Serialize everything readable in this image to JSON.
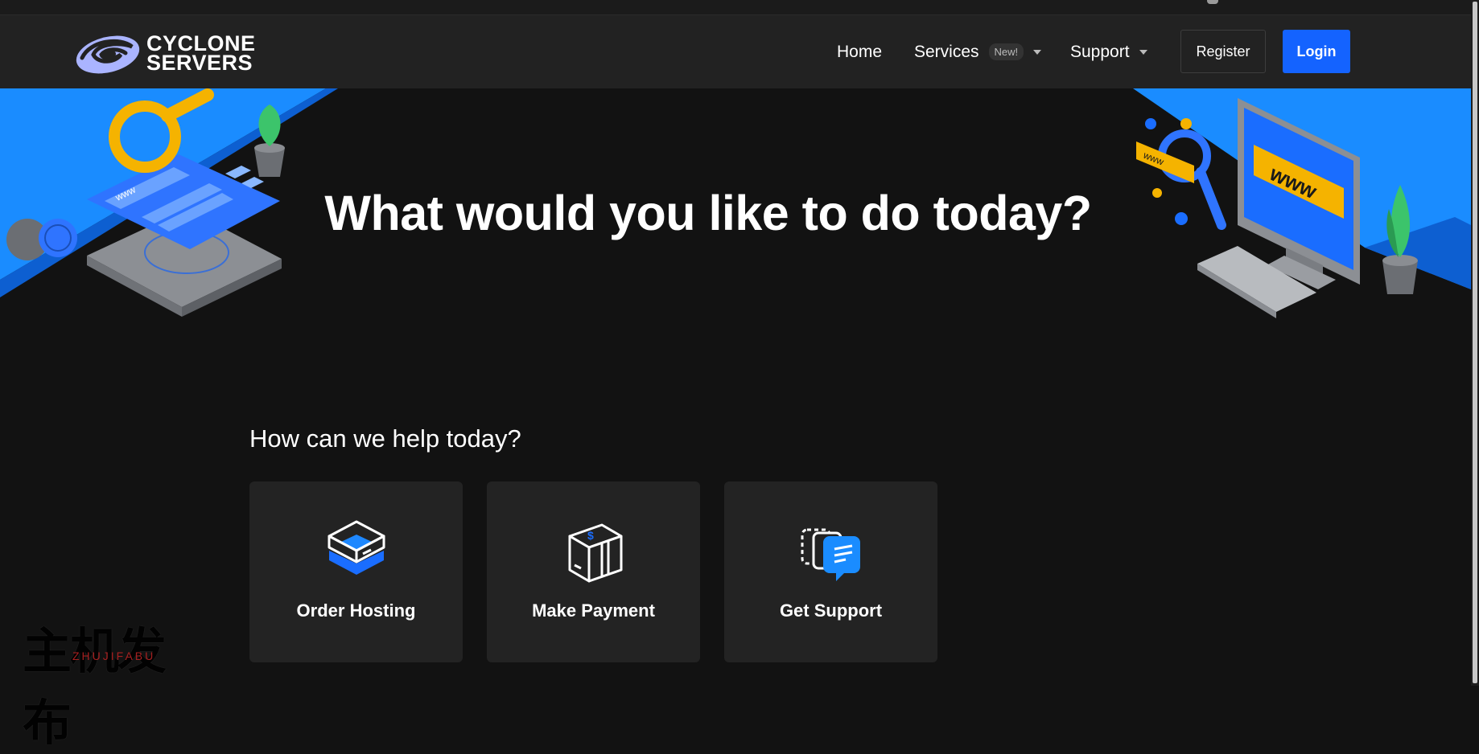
{
  "navbar": {
    "brand_line1": "CYCLONE",
    "brand_line2": "SERVERS",
    "home": "Home",
    "services": "Services",
    "services_badge": "New!",
    "support": "Support",
    "register": "Register",
    "login": "Login"
  },
  "hero": {
    "title": "What would you like to do today?"
  },
  "help": {
    "title": "How can we help today?",
    "cards": [
      {
        "label": "Order Hosting",
        "icon": "server-box-icon"
      },
      {
        "label": "Make Payment",
        "icon": "payment-box-icon"
      },
      {
        "label": "Get Support",
        "icon": "chat-bubbles-icon"
      }
    ]
  },
  "watermark": {
    "cn": "主机发布",
    "en": "ZHUJIFABU"
  },
  "colors": {
    "accent": "#1463ff",
    "navbar_bg": "#222222",
    "page_bg": "#121212",
    "card_bg": "#232323",
    "hero_blue": "#1a8cff",
    "yellow": "#f5b300"
  }
}
